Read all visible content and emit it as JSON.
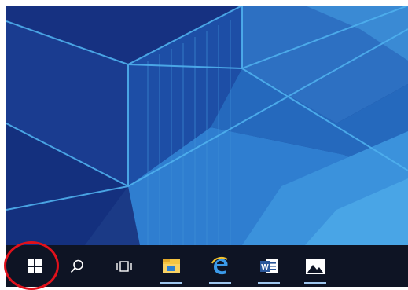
{
  "desktop": {
    "wallpaper_colors": [
      "#1b3a86",
      "#123487",
      "#1f5cb4",
      "#2b78c9",
      "#3d93d8",
      "#4aa6e4"
    ],
    "line_color": "#4fb0ee"
  },
  "taskbar": {
    "background": "#0e1424",
    "items": [
      {
        "name": "start-button",
        "icon": "windows-logo-icon",
        "active": false
      },
      {
        "name": "search-button",
        "icon": "search-icon",
        "active": false
      },
      {
        "name": "task-view-button",
        "icon": "task-view-icon",
        "active": false
      },
      {
        "name": "file-explorer-button",
        "icon": "folder-icon",
        "active": true
      },
      {
        "name": "edge-button",
        "icon": "edge-e-icon",
        "active": true
      },
      {
        "name": "word-button",
        "icon": "word-icon",
        "active": true
      },
      {
        "name": "photos-button",
        "icon": "photos-icon",
        "active": true
      }
    ]
  },
  "annotation": {
    "highlight_target": "start-button",
    "highlight_color": "#e0111b"
  },
  "icons": {
    "word_letter": "W"
  }
}
